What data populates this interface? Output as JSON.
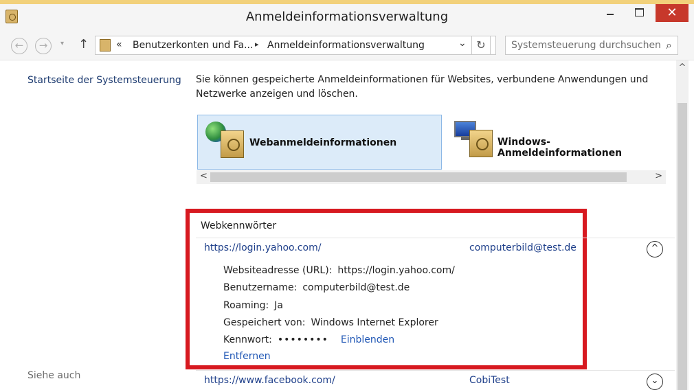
{
  "window": {
    "title": "Anmeldeinformationsverwaltung",
    "controls": {
      "minimize": "",
      "maximize": "",
      "close": "✕"
    }
  },
  "nav": {
    "back": "←",
    "forward": "→",
    "recent": "▾",
    "up": "↑",
    "breadcrumb": {
      "more": "«",
      "part1": "Benutzerkonten und Fa...",
      "separator": "▸",
      "part2": "Anmeldeinformationsverwaltung",
      "dropdown": "⌄"
    },
    "refresh": "↻",
    "search_placeholder": "Systemsteuerung durchsuchen",
    "search_icon": "⌕"
  },
  "sidebar": {
    "home_link": "Startseite der Systemsteuerung",
    "see_also": "Siehe auch"
  },
  "main": {
    "intro": "Sie können gespeicherte Anmeldeinformationen für Websites, verbundene Anwendungen und Netzwerke anzeigen und löschen.",
    "tiles": [
      {
        "label": "Webanmeldeinformationen",
        "selected": true
      },
      {
        "label": "Windows-Anmeldeinformationen",
        "selected": false
      }
    ],
    "scroll": {
      "left": "<",
      "right": ">",
      "up": "^"
    },
    "section_title": "Webkennwörter",
    "entries": [
      {
        "url": "https://login.yahoo.com/",
        "username": "computerbild@test.de",
        "toggle": "^",
        "details": {
          "url_label": "Websiteadresse (URL):",
          "url_value": "https://login.yahoo.com/",
          "user_label": "Benutzername:",
          "user_value": "computerbild@test.de",
          "roaming_label": "Roaming:",
          "roaming_value": "Ja",
          "saved_by_label": "Gespeichert von:",
          "saved_by_value": "Windows Internet Explorer",
          "password_label": "Kennwort:",
          "password_value": "••••••••",
          "reveal": "Einblenden",
          "remove": "Entfernen"
        }
      },
      {
        "url": "https://www.facebook.com/",
        "username": "CobiTest",
        "toggle": "⌄"
      }
    ]
  },
  "colors": {
    "highlight": "#d71920",
    "link": "#1e3f8a",
    "selected_tile": "#dcebf9",
    "close_button": "#c7382b"
  }
}
